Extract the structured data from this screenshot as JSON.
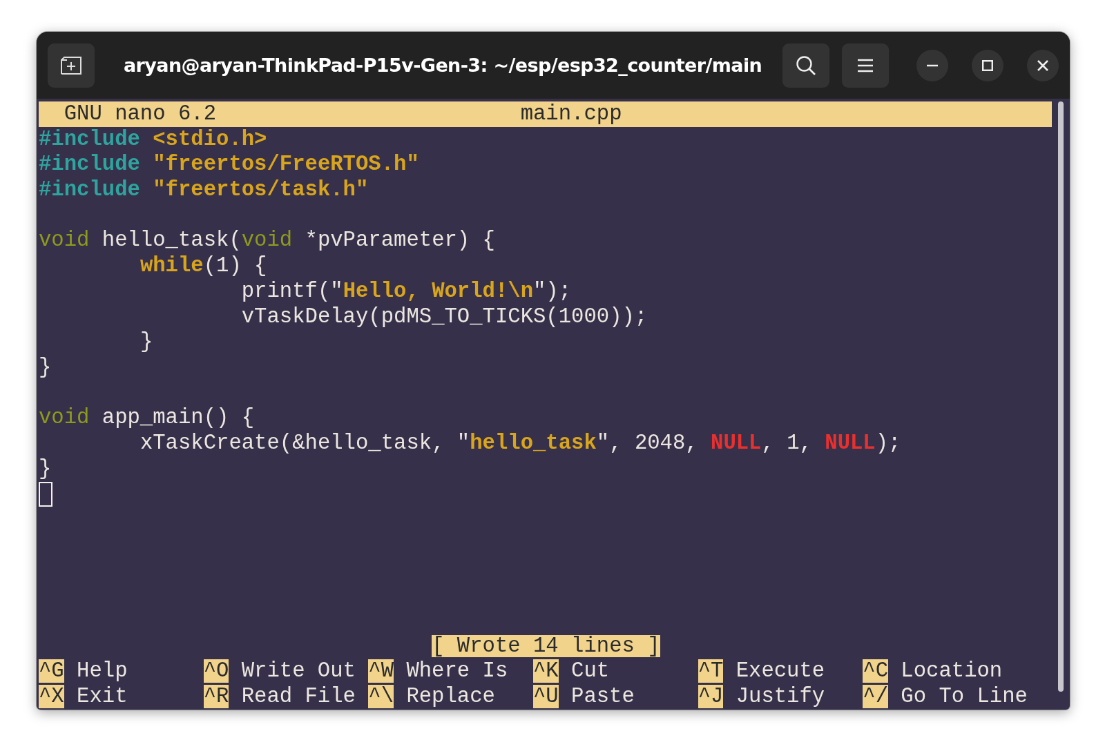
{
  "window": {
    "title": "aryan@aryan-ThinkPad-P15v-Gen-3: ~/esp/esp32_counter/main"
  },
  "editor": {
    "app": "GNU nano 6.2",
    "file": "main.cpp",
    "lines": [
      {
        "kind": "code",
        "tokens": [
          {
            "kind": "preproc",
            "text": "#include "
          },
          {
            "kind": "string",
            "text": "<stdio.h>"
          }
        ]
      },
      {
        "kind": "code",
        "tokens": [
          {
            "kind": "preproc",
            "text": "#include "
          },
          {
            "kind": "string",
            "text": "\"freertos/FreeRTOS.h\""
          }
        ]
      },
      {
        "kind": "code",
        "tokens": [
          {
            "kind": "preproc",
            "text": "#include "
          },
          {
            "kind": "string",
            "text": "\"freertos/task.h\""
          }
        ]
      },
      {
        "kind": "blank"
      },
      {
        "kind": "code",
        "tokens": [
          {
            "kind": "type",
            "text": "void"
          },
          {
            "kind": "plain",
            "text": " hello_task("
          },
          {
            "kind": "type",
            "text": "void"
          },
          {
            "kind": "plain",
            "text": " *pvParameter) {"
          }
        ]
      },
      {
        "kind": "code",
        "tokens": [
          {
            "kind": "keyword",
            "text": "\twhile"
          },
          {
            "kind": "plain",
            "text": "(1) {"
          }
        ]
      },
      {
        "kind": "code",
        "tokens": [
          {
            "kind": "plain",
            "text": "\t\tprintf(\""
          },
          {
            "kind": "string",
            "text": "Hello, World!\\n"
          },
          {
            "kind": "plain",
            "text": "\");"
          }
        ]
      },
      {
        "kind": "code",
        "tokens": [
          {
            "kind": "plain",
            "text": "\t\tvTaskDelay(pdMS_TO_TICKS(1000));"
          }
        ]
      },
      {
        "kind": "code",
        "tokens": [
          {
            "kind": "plain",
            "text": "\t}"
          }
        ]
      },
      {
        "kind": "code",
        "tokens": [
          {
            "kind": "plain",
            "text": "}"
          }
        ]
      },
      {
        "kind": "blank"
      },
      {
        "kind": "code",
        "tokens": [
          {
            "kind": "type",
            "text": "void"
          },
          {
            "kind": "plain",
            "text": " app_main() {"
          }
        ]
      },
      {
        "kind": "code",
        "tokens": [
          {
            "kind": "plain",
            "text": "\txTaskCreate(&hello_task, \""
          },
          {
            "kind": "string",
            "text": "hello_task"
          },
          {
            "kind": "plain",
            "text": "\", 2048, "
          },
          {
            "kind": "constant",
            "text": "NULL"
          },
          {
            "kind": "plain",
            "text": ", 1, "
          },
          {
            "kind": "constant",
            "text": "NULL"
          },
          {
            "kind": "plain",
            "text": ");"
          }
        ]
      },
      {
        "kind": "code",
        "tokens": [
          {
            "kind": "plain",
            "text": "}"
          }
        ]
      }
    ],
    "status": "[ Wrote 14 lines ]",
    "shortcuts": [
      [
        {
          "key": "^G",
          "label": "Help"
        },
        {
          "key": "^O",
          "label": "Write Out"
        },
        {
          "key": "^W",
          "label": "Where Is"
        },
        {
          "key": "^K",
          "label": "Cut"
        },
        {
          "key": "^T",
          "label": "Execute"
        },
        {
          "key": "^C",
          "label": "Location"
        }
      ],
      [
        {
          "key": "^X",
          "label": "Exit"
        },
        {
          "key": "^R",
          "label": "Read File"
        },
        {
          "key": "^\\",
          "label": "Replace"
        },
        {
          "key": "^U",
          "label": "Paste"
        },
        {
          "key": "^J",
          "label": "Justify"
        },
        {
          "key": "^/",
          "label": "Go To Line"
        }
      ]
    ]
  }
}
